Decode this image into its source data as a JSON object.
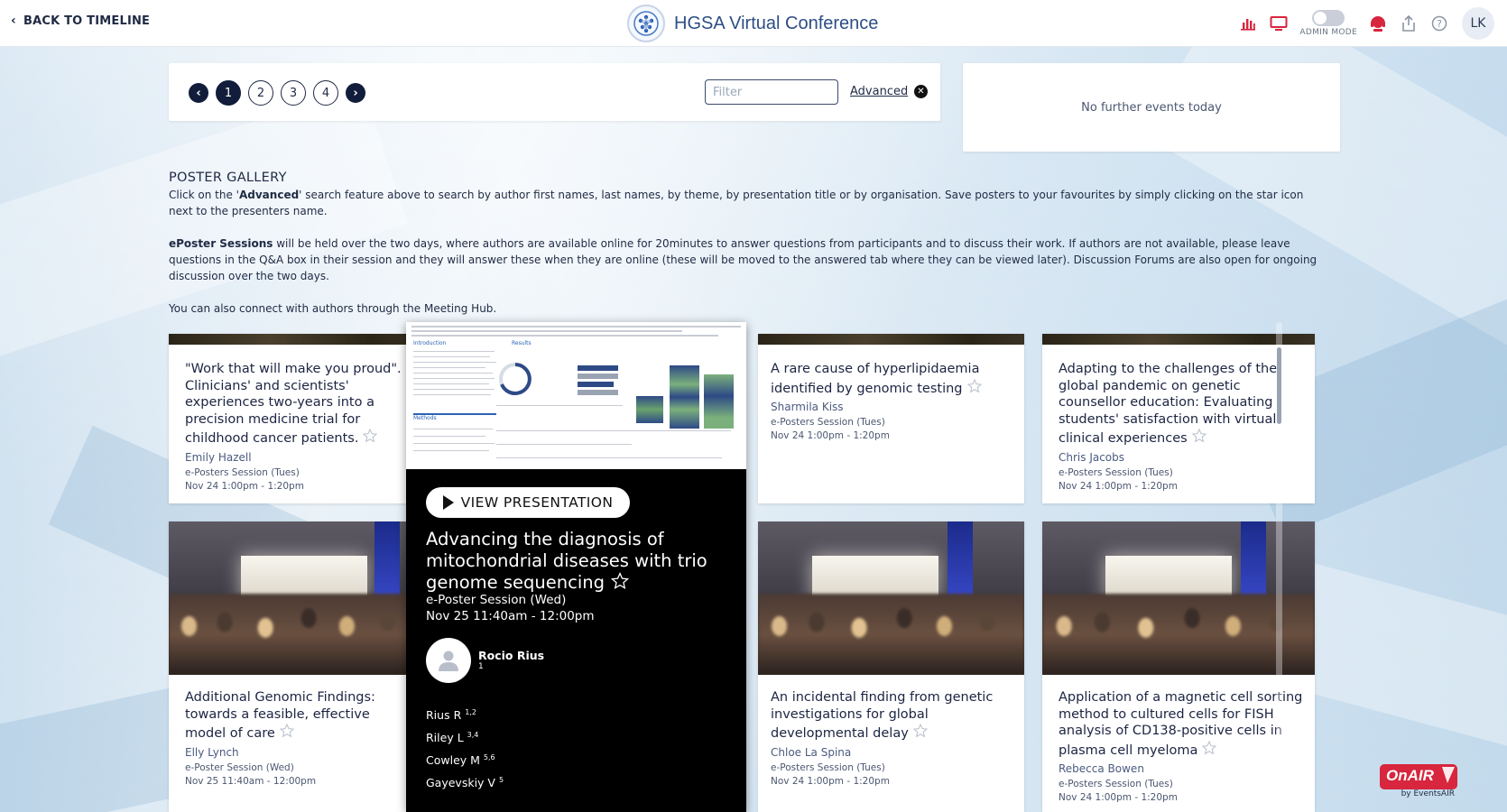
{
  "header": {
    "back_label": "BACK TO TIMELINE",
    "title": "HGSA Virtual Conference",
    "admin_mode_label": "ADMIN MODE",
    "user_initials": "LK",
    "icons": [
      "bar-chart-icon",
      "monitor-icon",
      "toggle-icon",
      "support-agent-icon",
      "share-icon",
      "help-icon"
    ]
  },
  "pager": {
    "pages": [
      "1",
      "2",
      "3",
      "4"
    ],
    "active_page": "1",
    "filter_placeholder": "Filter",
    "filter_value": "",
    "advanced_label": "Advanced"
  },
  "events": {
    "text": "No further events today"
  },
  "intro": {
    "heading": "POSTER GALLERY",
    "p1_prefix": "Click on the '",
    "p1_bold": "Advanced",
    "p1_suffix": "' search feature above to search by author first names, last names, by theme, by presentation title or by organisation. Save posters to your favourites by simply clicking on the star icon next to the presenters name.",
    "p2_bold": "ePoster Sessions",
    "p2_rest": " will be held over the two days, where authors are available online for 20minutes to answer questions from participants and to discuss their work. If authors are not available, please leave questions in the Q&A box in their session and they will answer these when they are online (these will be moved to the answered tab where they can be viewed later).  Discussion Forums are also open for ongoing discussion over the two days.",
    "p3": "You can also connect with authors through the Meeting Hub."
  },
  "cards": [
    {
      "title": "\"Work that will make you proud\". Clinicians' and scientists' experiences two-years into a precision medicine trial for childhood cancer patients.",
      "author": "Emily Hazell",
      "session": "e-Posters Session (Tues)",
      "time": "Nov 24 1:00pm - 1:20pm"
    },
    {
      "title": "A rare cause of hyperlipidaemia identified by genomic testing",
      "author": "Sharmila Kiss",
      "session": "e-Posters Session (Tues)",
      "time": "Nov 24 1:00pm - 1:20pm"
    },
    {
      "title": "Adapting to the challenges of the global pandemic on genetic counsellor education: Evaluating students' satisfaction with virtual clinical experiences",
      "author": "Chris Jacobs",
      "session": "e-Posters Session (Tues)",
      "time": "Nov 24 1:00pm - 1:20pm"
    },
    {
      "title": "Additional Genomic Findings: towards a feasible, effective model of care",
      "author": "Elly Lynch",
      "session": "e-Poster Session (Wed)",
      "time": "Nov 25 11:40am - 12:00pm"
    },
    {
      "title": "An incidental finding from genetic investigations for global developmental delay",
      "author": "Chloe La Spina",
      "session": "e-Posters Session (Tues)",
      "time": "Nov 24 1:00pm - 1:20pm"
    },
    {
      "title": "Application of a magnetic cell sorting method to cultured cells for FISH analysis of CD138-positive cells in plasma cell myeloma",
      "author": "Rebecca Bowen",
      "session": "e-Posters Session (Tues)",
      "time": "Nov 24 1:00pm - 1:20pm"
    }
  ],
  "detail": {
    "view_label": "VIEW PRESENTATION",
    "title": "Advancing the diagnosis of mitochondrial diseases with trio genome sequencing",
    "session": "e-Poster Session (Wed)",
    "time": "Nov 25 11:40am - 12:00pm",
    "presenter": "Rocio Rius",
    "presenter_num": "1",
    "authors": [
      {
        "name": "Rius R",
        "aff": "1,2"
      },
      {
        "name": "Riley L",
        "aff": "3,4"
      },
      {
        "name": "Cowley M",
        "aff": "5,6"
      },
      {
        "name": "Gayevskiy V",
        "aff": "5"
      }
    ],
    "poster_headings": {
      "intro": "Introduction",
      "results": "Results",
      "methods": "Methods"
    }
  },
  "onair": {
    "brand": "OnAIR",
    "by": "by EventsAIR"
  },
  "colors": {
    "navy": "#111d3a",
    "accent_red": "#d7263d",
    "brand_blue": "#2c4d86"
  }
}
